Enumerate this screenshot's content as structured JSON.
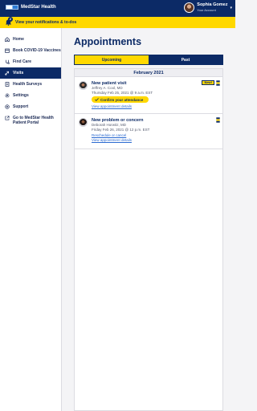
{
  "app": {
    "brand": "MedStar Health"
  },
  "user": {
    "name": "Sophia Gomez",
    "subtitle": "Your Account"
  },
  "notification": {
    "text": "View your notifications & to-dos",
    "count": "2"
  },
  "sidebar": {
    "items": [
      {
        "label": "Home",
        "icon": "home-icon",
        "active": false
      },
      {
        "label": "Book COVID-19 Vaccines",
        "icon": "calendar-icon",
        "active": false
      },
      {
        "label": "Find Care",
        "icon": "find-care-icon",
        "active": false
      },
      {
        "label": "Visits",
        "icon": "visits-icon",
        "active": true
      },
      {
        "label": "Health Surveys",
        "icon": "survey-icon",
        "active": false
      },
      {
        "label": "Settings",
        "icon": "gear-icon",
        "active": false
      },
      {
        "label": "Support",
        "icon": "support-icon",
        "active": false
      },
      {
        "label": "Go to MedStar Health Patient Portal",
        "icon": "external-link-icon",
        "active": false
      }
    ]
  },
  "main": {
    "title": "Appointments",
    "tabs": [
      {
        "label": "Upcoming",
        "selected": true
      },
      {
        "label": "Past",
        "selected": false
      }
    ],
    "month": "February 2021",
    "appointments": [
      {
        "title": "New patient visit",
        "doctor": "Jeffrey A. Cool, MD",
        "datetime": "Thursday Feb 25, 2021 @ 9 a.m. EST",
        "action_label": "Confirm your attendance",
        "details_link": "View appointment details",
        "badge": "New!"
      },
      {
        "title": "New problem or concern",
        "doctor": "Deborah Horwitz, MD",
        "datetime": "Friday Feb 26, 2021 @ 12 p.m. EST",
        "reschedule_link": "Reschedule or cancel",
        "details_link": "View appointment details"
      }
    ]
  },
  "colors": {
    "navy": "#0c2a66",
    "yellow": "#ffd800",
    "link": "#2c6bd1"
  }
}
